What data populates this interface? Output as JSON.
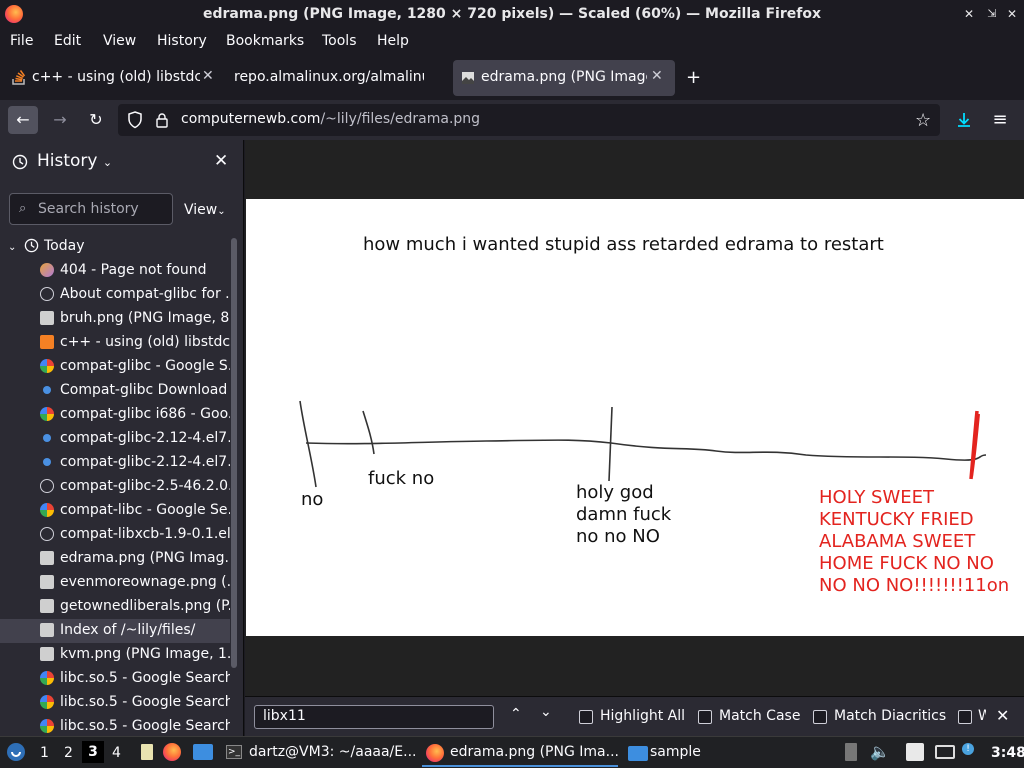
{
  "window": {
    "title": "edrama.png (PNG Image, 1280 × 720 pixels) — Scaled (60%) — Mozilla Firefox"
  },
  "menu": [
    "File",
    "Edit",
    "View",
    "History",
    "Bookmarks",
    "Tools",
    "Help"
  ],
  "tabs": [
    {
      "label": "c++ - using (old) libstdc+",
      "active": false
    },
    {
      "label": "repo.almalinux.org/almalinu",
      "active": false
    },
    {
      "label": "edrama.png (PNG Image",
      "active": true
    }
  ],
  "nav": {
    "url_host": "computernewb.com",
    "url_path": "/~lily/files/edrama.png"
  },
  "sidebar": {
    "title": "History",
    "search_placeholder": "Search history",
    "view_label": "View",
    "group_label": "Today",
    "items": [
      {
        "label": "404 - Page not found",
        "icon": "site-icon"
      },
      {
        "label": "About compat-glibc for ...",
        "icon": "globe-icon"
      },
      {
        "label": "bruh.png (PNG Image, 8...",
        "icon": "image-icon"
      },
      {
        "label": "c++ - using (old) libstdc...",
        "icon": "stackoverflow-icon"
      },
      {
        "label": "compat-glibc - Google S...",
        "icon": "google-icon"
      },
      {
        "label": "Compat-glibc Download ...",
        "icon": "dot-icon"
      },
      {
        "label": "compat-glibc i686 - Goo...",
        "icon": "google-icon"
      },
      {
        "label": "compat-glibc-2.12-4.el7...",
        "icon": "dot-icon"
      },
      {
        "label": "compat-glibc-2.12-4.el7...",
        "icon": "dot-icon"
      },
      {
        "label": "compat-glibc-2.5-46.2.0...",
        "icon": "globe-icon"
      },
      {
        "label": "compat-libc - Google Se...",
        "icon": "google-icon"
      },
      {
        "label": "compat-libxcb-1.9-0.1.el...",
        "icon": "globe-icon"
      },
      {
        "label": "edrama.png (PNG Imag...",
        "icon": "image-icon"
      },
      {
        "label": "evenmoreownage.png (...",
        "icon": "image-icon"
      },
      {
        "label": "getownedliberals.png (P...",
        "icon": "image-icon"
      },
      {
        "label": "Index of /~lily/files/",
        "icon": "image-icon",
        "selected": true
      },
      {
        "label": "kvm.png (PNG Image, 1...",
        "icon": "image-icon"
      },
      {
        "label": "libc.so.5 - Google Search",
        "icon": "google-icon"
      },
      {
        "label": "libc.so.5 - Google Search",
        "icon": "google-icon"
      },
      {
        "label": "libc.so.5 - Google Search",
        "icon": "google-icon"
      }
    ]
  },
  "image": {
    "heading": "how much i wanted stupid ass retarded edrama to restart",
    "label_no": "no",
    "label_fuck_no": "fuck no",
    "label_holy": [
      "holy god",
      "damn fuck",
      "no no NO"
    ],
    "label_red": [
      "HOLY SWEET",
      "KENTUCKY FRIED",
      "ALABAMA SWEET",
      "HOME FUCK NO NO",
      "NO NO NO!!!!!!!11on"
    ]
  },
  "findbar": {
    "value": "libx11",
    "highlight_all": "Highlight All",
    "match_case": "Match Case",
    "match_diacritics": "Match Diacritics",
    "whole_words": "W"
  },
  "taskbar": {
    "workspaces": [
      "1",
      "2",
      "3",
      "4"
    ],
    "tasks": [
      {
        "label": "dartz@VM3: ~/aaaa/E...",
        "icon": "terminal-icon"
      },
      {
        "label": "edrama.png (PNG Ima...",
        "icon": "firefox-icon",
        "active": true
      },
      {
        "label": "sample",
        "icon": "folder-icon"
      }
    ],
    "clock": "3:48"
  },
  "colors": {
    "accent": "#4a90d9",
    "download_icon": "#00ddff",
    "red_text": "#e3241f"
  }
}
